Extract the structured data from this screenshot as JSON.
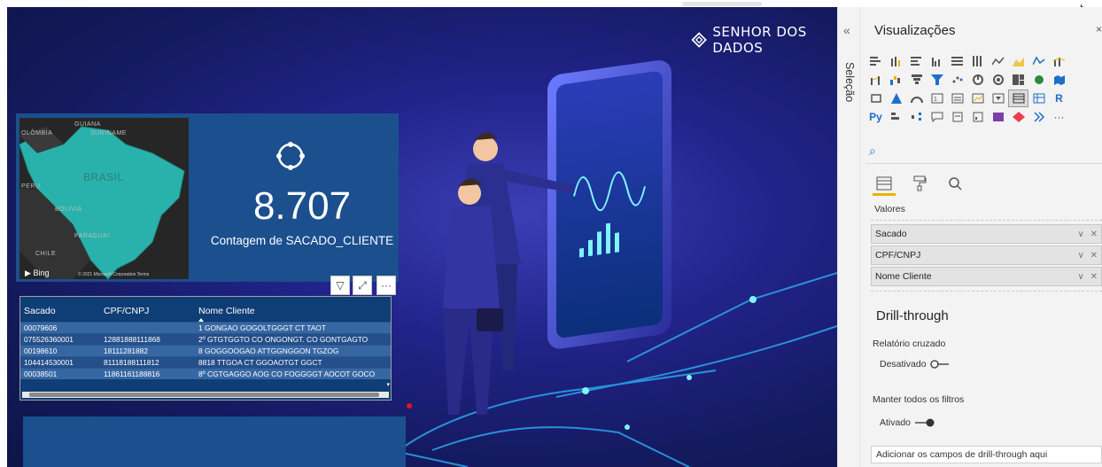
{
  "brand": {
    "name": "SENHOR DOS DADOS"
  },
  "kpi": {
    "value": "8.707",
    "label": "Contagem de SACADO_CLIENTE"
  },
  "map": {
    "labels": [
      "OLÔMBIA",
      "GUIANA",
      "SURINAME",
      "PERU",
      "BOLÍVIA",
      "PARAGUAI",
      "CHILE",
      "BRASIL"
    ],
    "bing": "Bing",
    "copyright": "© 2021 Microsoft Corporation Terms"
  },
  "table": {
    "columns": [
      "Sacado",
      "CPF/CNPJ",
      "Nome Cliente"
    ],
    "rows": [
      [
        "00079606",
        "",
        "1 GONGAO GOGOLTGGGT CT TAOT"
      ],
      [
        "075526360001",
        "12881888111868",
        "2º GTGTGGTO CO ONGONGT. CO GONTGAGTO"
      ],
      [
        "00198610",
        "18111281882",
        "8 GOGGOOGAO ATTGGNGGON TGZOG"
      ],
      [
        "104414530001",
        "81118188111812",
        "8818 TTGOA CT GGOAOTGT GGCT"
      ],
      [
        "00038501",
        "11861161188816",
        "8º CGTGAGGO AOG CO FOGGGGT AOCOT GOCO"
      ]
    ]
  },
  "selection_pane": {
    "label": "Seleção"
  },
  "visualizations": {
    "title": "Visualizações",
    "values_label": "Valores",
    "fields": [
      "Sacado",
      "CPF/CNPJ",
      "Nome Cliente"
    ],
    "drill_title": "Drill-through",
    "cross_report_label": "Relatório cruzado",
    "cross_report_state": "Desativado",
    "keep_filters_label": "Manter todos os filtros",
    "keep_filters_state": "Ativado",
    "drop_placeholder": "Adicionar os campos de drill-through aqui",
    "r_label": "R",
    "py_label": "Py",
    "more": "···"
  },
  "colors": {
    "accent": "#e8b300",
    "kpi_card": "#1b4f8e",
    "table_bg": "#0f3d75",
    "teal": "#27b3ad"
  }
}
